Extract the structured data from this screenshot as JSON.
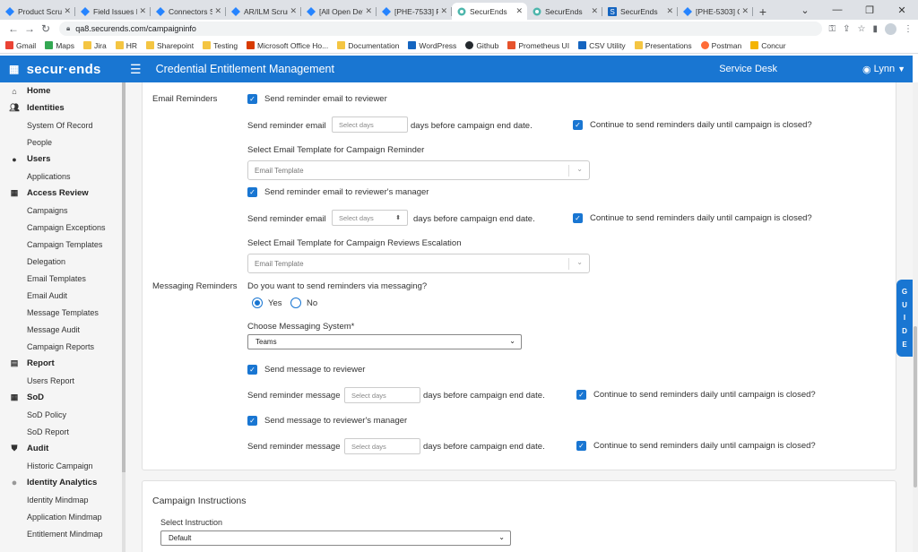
{
  "browser": {
    "tabs": [
      {
        "title": "Product Scrum",
        "icon": "jira-icon"
      },
      {
        "title": "Field Issues Ka",
        "icon": "jira-icon"
      },
      {
        "title": "Connectors Sc",
        "icon": "jira-icon"
      },
      {
        "title": "AR/ILM Scrum",
        "icon": "jira-icon"
      },
      {
        "title": "[All Open Defe",
        "icon": "jira-icon"
      },
      {
        "title": "[PHE-7533] Pu",
        "icon": "jira-icon"
      },
      {
        "title": "SecurEnds",
        "icon": "securends-icon",
        "active": true
      },
      {
        "title": "SecurEnds",
        "icon": "securends-icon"
      },
      {
        "title": "SecurEnds",
        "icon": "securends-s-icon"
      },
      {
        "title": "[PHE-5303] Ca",
        "icon": "jira-icon"
      }
    ],
    "new_tab": "+",
    "url": "qa8.securends.com/campaigninfo",
    "bookmarks": [
      {
        "label": "Gmail",
        "icon": "gmail-icon"
      },
      {
        "label": "Maps",
        "icon": "maps-icon"
      },
      {
        "label": "Jira",
        "icon": "folder-icon"
      },
      {
        "label": "HR",
        "icon": "folder-icon"
      },
      {
        "label": "Sharepoint",
        "icon": "folder-icon"
      },
      {
        "label": "Testing",
        "icon": "folder-icon"
      },
      {
        "label": "Microsoft Office Ho...",
        "icon": "office-icon"
      },
      {
        "label": "Documentation",
        "icon": "folder-icon"
      },
      {
        "label": "WordPress",
        "icon": "securends-s-icon"
      },
      {
        "label": "Github",
        "icon": "github-icon"
      },
      {
        "label": "Prometheus UI",
        "icon": "prometheus-icon"
      },
      {
        "label": "CSV Utility",
        "icon": "csv-icon"
      },
      {
        "label": "Presentations",
        "icon": "folder-icon"
      },
      {
        "label": "Postman",
        "icon": "postman-icon"
      },
      {
        "label": "Concur",
        "icon": "concur-icon"
      }
    ]
  },
  "header": {
    "logo": "secur·ends",
    "title": "Credential Entitlement Management",
    "service_desk": "Service Desk",
    "user": "Lynn",
    "brand_color": "#1976d2"
  },
  "sidebar": {
    "sections": [
      {
        "label": "Home",
        "icon": "home-icon",
        "items": []
      },
      {
        "label": "Identities",
        "icon": "people-icon",
        "items": [
          "System Of Record",
          "People"
        ]
      },
      {
        "label": "Users",
        "icon": "user-icon",
        "items": [
          "Applications"
        ]
      },
      {
        "label": "Access Review",
        "icon": "grid-icon",
        "items": [
          "Campaigns",
          "Campaign Exceptions",
          "Campaign Templates",
          "Delegation",
          "Email Templates",
          "Email Audit",
          "Message Templates",
          "Message Audit",
          "Campaign Reports"
        ]
      },
      {
        "label": "Report",
        "icon": "report-icon",
        "items": [
          "Users Report"
        ]
      },
      {
        "label": "SoD",
        "icon": "grid-icon",
        "items": [
          "SoD Policy",
          "SoD Report"
        ]
      },
      {
        "label": "Audit",
        "icon": "shield-icon",
        "items": [
          "Historic Campaign"
        ]
      },
      {
        "label": "Identity Analytics",
        "icon": "circle-icon",
        "items": [
          "Identity Mindmap",
          "Application Mindmap",
          "Entitlement Mindmap"
        ]
      }
    ]
  },
  "form": {
    "email_reminders_label": "Email Reminders",
    "send_to_reviewer": "Send reminder email to reviewer",
    "send_reminder_email": "Send reminder email",
    "select_days": "Select days",
    "days_before": "days before campaign end date.",
    "continue_daily": "Continue to send reminders daily until campaign is closed?",
    "select_template_reminder": "Select Email Template for Campaign Reminder",
    "email_template": "Email Template",
    "send_to_manager": "Send reminder email to reviewer's manager",
    "select_template_escalation": "Select Email Template for Campaign Reviews Escalation",
    "messaging_reminders_label": "Messaging Reminders",
    "messaging_question": "Do you want to send reminders via messaging?",
    "yes": "Yes",
    "no": "No",
    "choose_messaging": "Choose Messaging System*",
    "messaging_system": "Teams",
    "send_msg_reviewer": "Send message to reviewer",
    "send_reminder_message": "Send reminder message",
    "send_msg_manager": "Send message to reviewer's manager"
  },
  "instructions": {
    "title": "Campaign Instructions",
    "select_label": "Select Instruction",
    "selected": "Default"
  },
  "guide": [
    "G",
    "U",
    "I",
    "D",
    "E"
  ]
}
